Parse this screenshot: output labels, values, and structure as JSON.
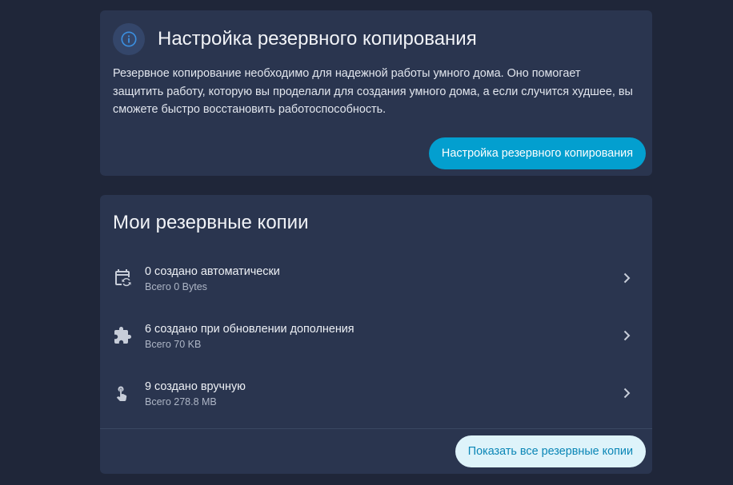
{
  "setup_card": {
    "title": "Настройка резервного копирования",
    "description": "Резервное копирование необходимо для надежной работы умного дома. Оно помогает защитить работу, которую вы проделали для создания умного дома, а если случится худшее, вы сможете быстро восстановить работоспособность.",
    "button_label": "Настройка резервного копирования",
    "icon": "info-icon"
  },
  "backups_card": {
    "title": "Мои резервные копии",
    "items": [
      {
        "primary": "0 создано автоматически",
        "secondary": "Всего 0 Bytes",
        "icon": "calendar-sync-icon"
      },
      {
        "primary": "6 создано при обновлении дополнения",
        "secondary": "Всего 70 KB",
        "icon": "puzzle-icon"
      },
      {
        "primary": "9 создано вручную",
        "secondary": "Всего 278.8 MB",
        "icon": "gesture-tap-icon"
      }
    ],
    "show_all_label": "Показать все резервные копии"
  },
  "colors": {
    "background": "#1f2639",
    "card": "#2a354f",
    "primary_button": "#039fcf",
    "secondary_button_bg": "#def3fa",
    "secondary_button_text": "#0a86b6",
    "info_icon": "#3b8fe0"
  }
}
